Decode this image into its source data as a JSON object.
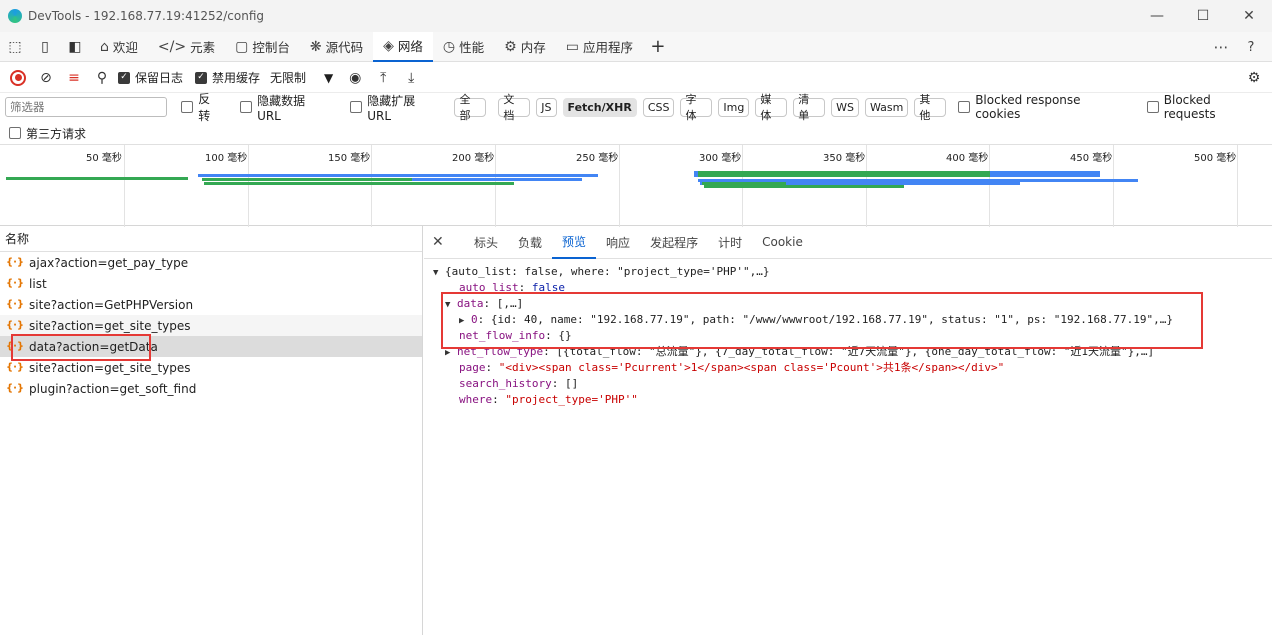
{
  "window": {
    "title": "DevTools - 192.168.77.19:41252/config"
  },
  "tabs": [
    {
      "label": "欢迎",
      "icon": "home-icon"
    },
    {
      "label": "元素",
      "icon": "code-icon"
    },
    {
      "label": "控制台",
      "icon": "console-icon"
    },
    {
      "label": "源代码",
      "icon": "bug-icon"
    },
    {
      "label": "网络",
      "icon": "wifi-icon",
      "active": true
    },
    {
      "label": "性能",
      "icon": "gauge-icon"
    },
    {
      "label": "内存",
      "icon": "memory-icon"
    },
    {
      "label": "应用程序",
      "icon": "application-icon"
    }
  ],
  "toolbar": {
    "preserve_log": "保留日志",
    "disable_cache": "禁用缓存",
    "throttle": "无限制"
  },
  "filter": {
    "placeholder": "筛选器",
    "invert": "反转",
    "hide_data_url": "隐藏数据 URL",
    "hide_ext_url": "隐藏扩展 URL",
    "types": [
      "全部",
      "文档",
      "JS",
      "Fetch/XHR",
      "CSS",
      "字体",
      "Img",
      "媒体",
      "清单",
      "WS",
      "Wasm",
      "其他"
    ],
    "active_type": "Fetch/XHR",
    "blocked_cookies": "Blocked response cookies",
    "blocked_requests": "Blocked requests",
    "third_party": "第三方请求"
  },
  "timeline": {
    "ticks": [
      {
        "value": "50",
        "unit": "毫秒"
      },
      {
        "value": "100",
        "unit": "毫秒"
      },
      {
        "value": "150",
        "unit": "毫秒"
      },
      {
        "value": "200",
        "unit": "毫秒"
      },
      {
        "value": "250",
        "unit": "毫秒"
      },
      {
        "value": "300",
        "unit": "毫秒"
      },
      {
        "value": "350",
        "unit": "毫秒"
      },
      {
        "value": "400",
        "unit": "毫秒"
      },
      {
        "value": "450",
        "unit": "毫秒"
      },
      {
        "value": "500",
        "unit": "毫秒"
      }
    ]
  },
  "requests": {
    "header": "名称",
    "items": [
      "ajax?action=get_pay_type",
      "list",
      "site?action=GetPHPVersion",
      "site?action=get_site_types",
      "data?action=getData",
      "site?action=get_site_types",
      "plugin?action=get_soft_find"
    ]
  },
  "detail": {
    "tabs": [
      "标头",
      "负载",
      "预览",
      "响应",
      "发起程序",
      "计时",
      "Cookie"
    ],
    "active_tab": "预览",
    "preview": {
      "root": "{auto_list: false, where: \"project_type='PHP'\",…}",
      "auto_list_key": "auto_list",
      "auto_list_val": "false",
      "data_key": "data",
      "data_val": "[,…]",
      "item0_key": "0",
      "item0_val": "{id: 40, name: \"192.168.77.19\", path: \"/www/wwwroot/192.168.77.19\", status: \"1\", ps: \"192.168.77.19\",…}",
      "net_flow_info_key": "net_flow_info",
      "net_flow_info_val": "{}",
      "net_flow_type_key": "net_flow_type",
      "net_flow_type_val": "[{total_flow: \"总流量\"}, {7_day_total_flow: \"近7天流量\"}, {one_day_total_flow: \"近1天流量\"},…]",
      "page_key": "page",
      "page_val": "\"<div><span class='Pcurrent'>1</span><span class='Pcount'>共1条</span></div>\"",
      "search_history_key": "search_history",
      "search_history_val": "[]",
      "where_key": "where",
      "where_val": "\"project_type='PHP'\""
    }
  }
}
